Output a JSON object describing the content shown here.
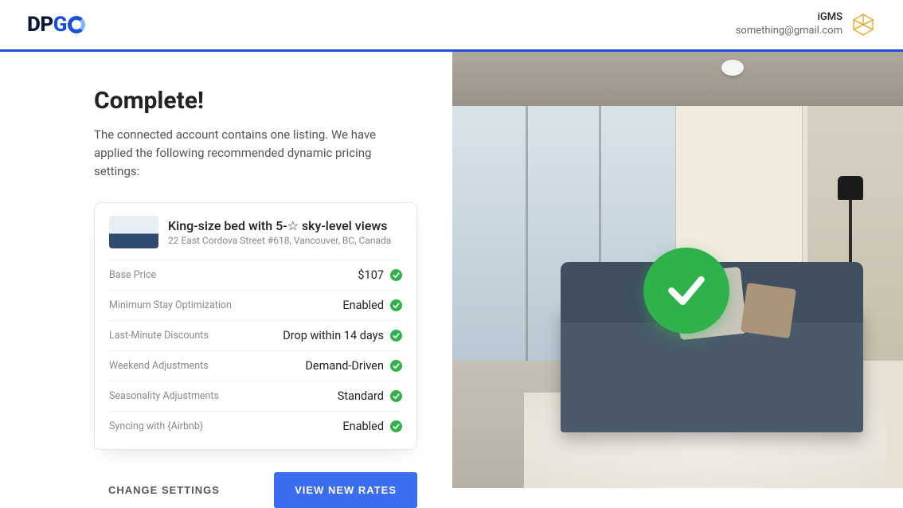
{
  "header": {
    "logo": {
      "dp": "DP",
      "g": "G"
    },
    "user_name": "iGMS",
    "user_email": "something@gmail.com"
  },
  "panel": {
    "title": "Complete!",
    "subtitle": "The connected account contains one listing. We have applied the following recommended dynamic pricing settings:"
  },
  "listing": {
    "title": "King-size bed with 5-☆ sky-level views",
    "address": "22 East Cordova Street #618, Vancouver, BC, Canada"
  },
  "settings": [
    {
      "label": "Base Price",
      "value": "$107"
    },
    {
      "label": "Minimum Stay Optimization",
      "value": "Enabled"
    },
    {
      "label": "Last-Minute Discounts",
      "value": "Drop within 14 days"
    },
    {
      "label": "Weekend Adjustments",
      "value": "Demand-Driven"
    },
    {
      "label": "Seasonality Adjustments",
      "value": "Standard"
    },
    {
      "label": "Syncing with {Airbnb}",
      "value": "Enabled"
    }
  ],
  "actions": {
    "secondary": "CHANGE SETTINGS",
    "primary": "VIEW NEW RATES"
  },
  "colors": {
    "primary": "#3b6df0",
    "success": "#2fb24c"
  }
}
